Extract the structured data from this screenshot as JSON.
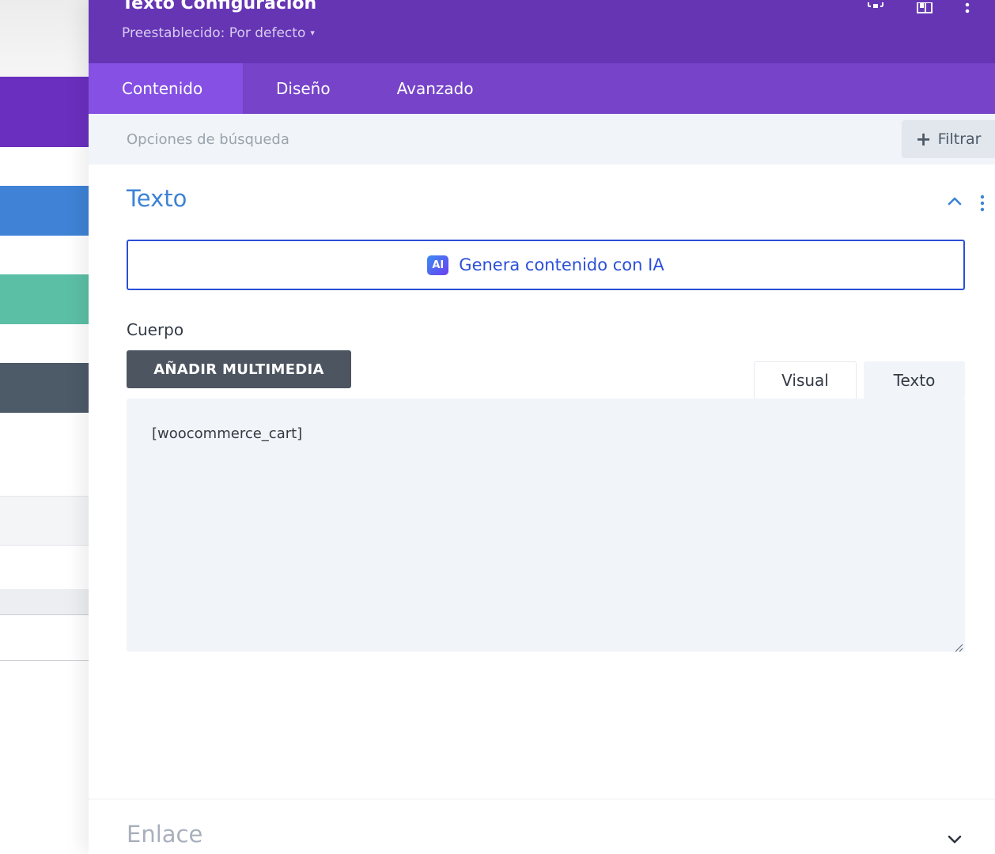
{
  "header": {
    "title": "Texto Configuración",
    "preset": "Preestablecido: Por defecto",
    "preset_caret": "▾"
  },
  "tabs": [
    {
      "label": "Contenido",
      "active": true
    },
    {
      "label": "Diseño",
      "active": false
    },
    {
      "label": "Avanzado",
      "active": false
    }
  ],
  "search": {
    "placeholder": "Opciones de búsqueda",
    "filter_label": "Filtrar",
    "filter_icon": "+"
  },
  "text_section": {
    "title": "Texto",
    "ai_badge": "AI",
    "ai_button_label": "Genera contenido con IA",
    "body_label": "Cuerpo",
    "add_media_label": "AÑADIR MULTIMEDIA",
    "editor_tabs": [
      "Visual",
      "Texto"
    ],
    "active_editor_tab": "Texto",
    "body_value": "[woocommerce_cart]"
  },
  "link_section": {
    "title": "Enlace"
  },
  "colors": {
    "header_bg": "#6535b4",
    "tabs_bg": "#7643c9",
    "active_tab_bg": "#8550e3",
    "section_title": "#3d83d6",
    "ai_button": "#2b4fd8",
    "media_button": "#4d5561"
  }
}
